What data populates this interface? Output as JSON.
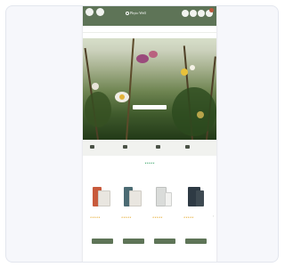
{
  "header": {
    "logo_text": "Phyto Well",
    "left_caption": "",
    "cart_count": "",
    "icons": [
      "home-icon",
      "user-icon",
      "search-icon",
      "account-icon",
      "heart-icon",
      "cart-icon"
    ]
  },
  "nav": {
    "items": [
      "",
      "",
      "",
      "",
      "",
      "",
      "",
      ""
    ]
  },
  "subnav": {
    "items": [
      "",
      "",
      "",
      "",
      ""
    ]
  },
  "hero": {
    "title": "",
    "subtitle": "",
    "cta_label": ""
  },
  "benefits": [
    {
      "icon": "truck-icon",
      "text": ""
    },
    {
      "icon": "leaf-icon",
      "text": ""
    },
    {
      "icon": "badge-icon",
      "text": ""
    },
    {
      "icon": "truck-icon",
      "text": ""
    }
  ],
  "rating": {
    "label": "",
    "stars": "★★★★★",
    "score": ""
  },
  "section": {
    "title": ""
  },
  "products": [
    {
      "name": "",
      "stars": "★★★★★",
      "price": "",
      "old_price": "",
      "button": ""
    },
    {
      "name": "",
      "stars": "★★★★★",
      "price": "",
      "old_price": "",
      "button": ""
    },
    {
      "name": "",
      "stars": "★★★★★",
      "price": "",
      "old_price": "",
      "button": ""
    },
    {
      "name": "",
      "stars": "★★★★★",
      "price": "",
      "old_price": "",
      "button": ""
    }
  ],
  "colors": {
    "brand": "#5e7457",
    "accent": "#b8583d",
    "star": "#e4a82a",
    "rating_green": "#2e9e5e"
  }
}
